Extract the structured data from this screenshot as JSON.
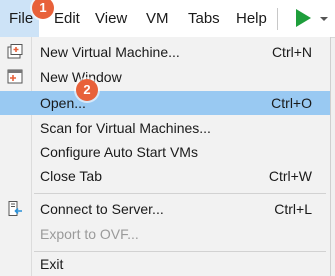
{
  "menubar": {
    "items": [
      "File",
      "Edit",
      "View",
      "VM",
      "Tabs",
      "Help"
    ]
  },
  "badges": [
    "1",
    "2"
  ],
  "file_menu": {
    "items": [
      {
        "label": "New Virtual Machine...",
        "shortcut": "Ctrl+N",
        "icon": "new-vm-icon"
      },
      {
        "label": "New Window",
        "shortcut": "",
        "icon": "new-window-icon"
      },
      {
        "label": "Open...",
        "shortcut": "Ctrl+O",
        "highlighted": true
      },
      {
        "label": "Scan for Virtual Machines...",
        "shortcut": ""
      },
      {
        "label": "Configure Auto Start VMs",
        "shortcut": ""
      },
      {
        "label": "Close Tab",
        "shortcut": "Ctrl+W"
      },
      {
        "label": "Connect to Server...",
        "shortcut": "Ctrl+L",
        "icon": "connect-server-icon"
      },
      {
        "label": "Export to OVF...",
        "shortcut": "",
        "disabled": true
      },
      {
        "label": "Exit",
        "shortcut": ""
      }
    ]
  },
  "colors": {
    "highlight": "#99c9f2",
    "badge": "#e8613a",
    "play": "#1e9e3b"
  }
}
